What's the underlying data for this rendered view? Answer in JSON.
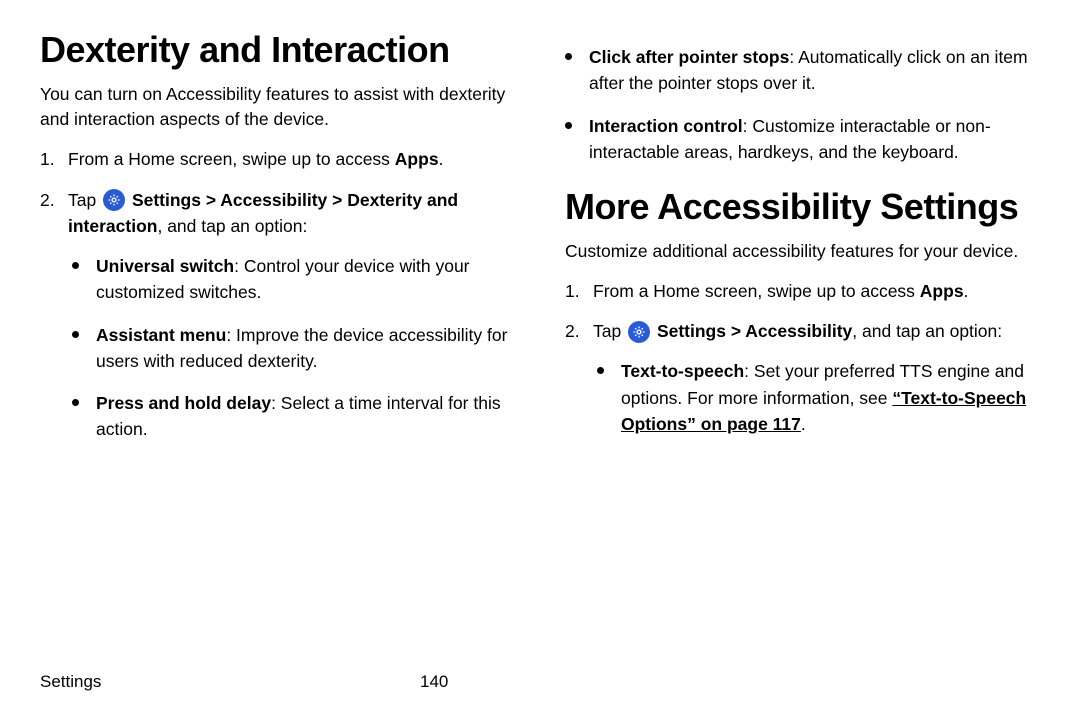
{
  "left": {
    "title": "Dexterity and Interaction",
    "intro": "You can turn on Accessibility features to assist with dexterity and interaction aspects of the device.",
    "step1_pre": "From a Home screen, swipe up to access ",
    "step1_apps": "Apps",
    "step1_post": ".",
    "step2_pre": "Tap ",
    "step2_path1": " Settings > Accessibility > Dexterity and interaction",
    "step2_post": ", and tap an option:",
    "b1_label": "Universal switch",
    "b1_text": ": Control your device with your customized switches.",
    "b2_label": "Assistant menu",
    "b2_text": ": Improve the device accessibility for users with reduced dexterity.",
    "b3_label": "Press and hold delay",
    "b3_text": ": Select a time interval for this action."
  },
  "right_top": {
    "b1_label": "Click after pointer stops",
    "b1_text": ": Automatically click on an item after the pointer stops over it.",
    "b2_label": "Interaction control",
    "b2_text": ": Customize interactable or non-interactable areas, hardkeys, and the keyboard."
  },
  "right": {
    "title": "More Accessibility Settings",
    "intro": "Customize additional accessibility features for your device.",
    "step1_pre": "From a Home screen, swipe up to access ",
    "step1_apps": "Apps",
    "step1_post": ".",
    "step2_pre": "Tap ",
    "step2_path1": " Settings > Accessibility",
    "step2_post": ", and tap an option:",
    "b1_label": "Text-to-speech",
    "b1_text": ": Set your preferred TTS engine and options. For more information, see ",
    "b1_xref": "“Text-to-Speech Options” on page 117",
    "b1_post": "."
  },
  "footer": {
    "section": "Settings",
    "page": "140"
  }
}
